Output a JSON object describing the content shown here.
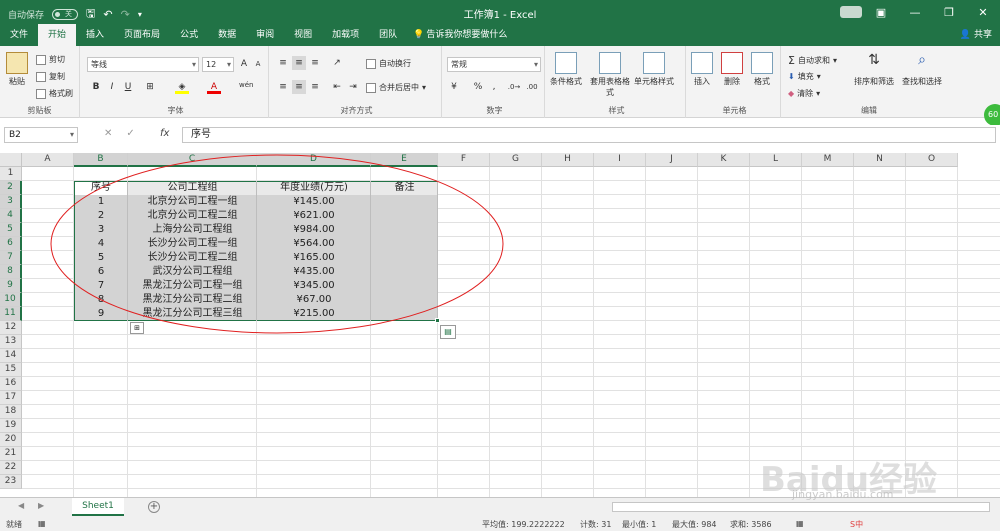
{
  "titlebar": {
    "autosave_label": "自动保存",
    "autosave_state": "关",
    "title": "工作簿1 - Excel"
  },
  "menu": {
    "tabs": [
      "文件",
      "开始",
      "插入",
      "页面布局",
      "公式",
      "数据",
      "审阅",
      "视图",
      "加载项",
      "团队"
    ],
    "active_tab": "开始",
    "tell_me": "告诉我你想要做什么",
    "share": "共享"
  },
  "ribbon": {
    "clipboard": {
      "paste": "粘贴",
      "cut": "剪切",
      "copy": "复制",
      "format_painter": "格式刷",
      "label": "剪贴板"
    },
    "font": {
      "name": "等线",
      "size": "12",
      "bold": "B",
      "italic": "I",
      "underline": "U",
      "label": "字体",
      "grow": "A",
      "shrink": "A",
      "wen": "wén"
    },
    "alignment": {
      "wrap": "自动换行",
      "merge": "合并后居中",
      "label": "对齐方式"
    },
    "number": {
      "format": "常规",
      "label": "数字",
      "percent": "%",
      "comma": ","
    },
    "styles": {
      "conditional": "条件格式",
      "table": "套用表格格式",
      "cell_styles": "单元格样式",
      "label": "样式"
    },
    "cells": {
      "insert": "插入",
      "delete": "删除",
      "format": "格式",
      "label": "单元格"
    },
    "editing": {
      "autosum": "自动求和",
      "fill": "填充",
      "clear": "清除",
      "sort": "排序和筛选",
      "find": "查找和选择",
      "label": "编辑"
    }
  },
  "formula_bar": {
    "name_box": "B2",
    "fx": "fx",
    "content": "序号"
  },
  "columns": [
    "A",
    "B",
    "C",
    "D",
    "E",
    "F",
    "G",
    "H",
    "I",
    "J",
    "K",
    "L",
    "M",
    "N",
    "O"
  ],
  "rows": [
    "1",
    "2",
    "3",
    "4",
    "5",
    "6",
    "7",
    "8",
    "9",
    "10",
    "11",
    "12",
    "13",
    "14",
    "15",
    "16",
    "17",
    "18",
    "19",
    "20",
    "21",
    "22",
    "23"
  ],
  "table": {
    "headers": [
      "序号",
      "公司工程组",
      "年度业绩(万元)",
      "备注"
    ],
    "rows": [
      [
        "1",
        "北京分公司工程一组",
        "¥145.00",
        ""
      ],
      [
        "2",
        "北京分公司工程二组",
        "¥621.00",
        ""
      ],
      [
        "3",
        "上海分公司工程组",
        "¥984.00",
        ""
      ],
      [
        "4",
        "长沙分公司工程一组",
        "¥564.00",
        ""
      ],
      [
        "5",
        "长沙分公司工程二组",
        "¥165.00",
        ""
      ],
      [
        "6",
        "武汉分公司工程组",
        "¥435.00",
        ""
      ],
      [
        "7",
        "黑龙江分公司工程一组",
        "¥345.00",
        ""
      ],
      [
        "8",
        "黑龙江分公司工程二组",
        "¥67.00",
        ""
      ],
      [
        "9",
        "黑龙江分公司工程三组",
        "¥215.00",
        ""
      ]
    ]
  },
  "sheet_tabs": [
    "Sheet1"
  ],
  "status": {
    "mode": "就绪",
    "average": "平均值: 199.2222222",
    "count": "计数: 31",
    "min": "最小值: 1",
    "max": "最大值: 984",
    "sum": "求和: 3586"
  },
  "watermark": {
    "text": "Baidu经验",
    "url": "jingyan.baidu.com"
  },
  "badge": "60",
  "colors": {
    "accent": "#217346",
    "selection": "#d3d3d3",
    "ellipse": "#e02020"
  }
}
